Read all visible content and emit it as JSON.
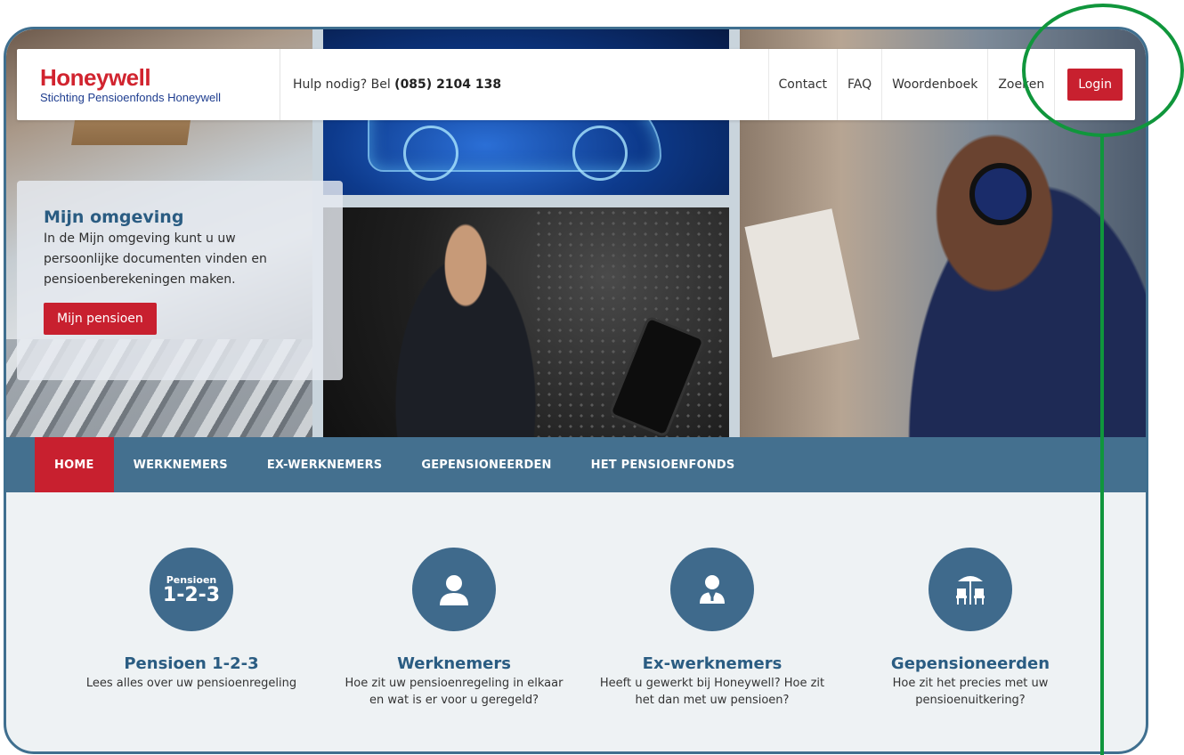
{
  "header": {
    "logo_word": "Honeywell",
    "logo_sub": "Stichting Pensioenfonds Honeywell",
    "help_prefix": "Hulp nodig? Bel ",
    "help_phone": "(085) 2104 138",
    "links": [
      "Contact",
      "FAQ",
      "Woordenboek",
      "Zoeken"
    ],
    "login_label": "Login"
  },
  "card": {
    "title": "Mijn omgeving",
    "text": "In de Mijn omgeving kunt u uw persoonlijke documenten vinden en pensioenberekeningen maken.",
    "button": "Mijn pensioen"
  },
  "mainnav": {
    "items": [
      "HOME",
      "WERKNEMERS",
      "EX-WERKNEMERS",
      "GEPENSIONEERDEN",
      "HET PENSIOENFONDS"
    ],
    "active": "HOME"
  },
  "features": [
    {
      "icon": "pensioen-123-icon",
      "icon_small": "Pensioen",
      "icon_big": "1-2-3",
      "title": "Pensioen 1-2-3",
      "desc": "Lees alles over uw pensioenregeling"
    },
    {
      "icon": "person-icon",
      "title": "Werknemers",
      "desc": "Hoe zit uw pensioenregeling in elkaar en wat is er voor u geregeld?"
    },
    {
      "icon": "person-suit-icon",
      "title": "Ex-werknemers",
      "desc": "Heeft u gewerkt bij Honeywell? Hoe zit het dan met uw pensioen?"
    },
    {
      "icon": "beach-chairs-icon",
      "title": "Gepensioneerden",
      "desc": "Hoe zit het precies met uw pensioenuitkering?"
    }
  ],
  "colors": {
    "brand_red": "#c8202f",
    "nav_blue": "#44708f",
    "circle_blue": "#3f6a8c",
    "title_blue": "#2a5c82",
    "annotation_green": "#10963c"
  }
}
